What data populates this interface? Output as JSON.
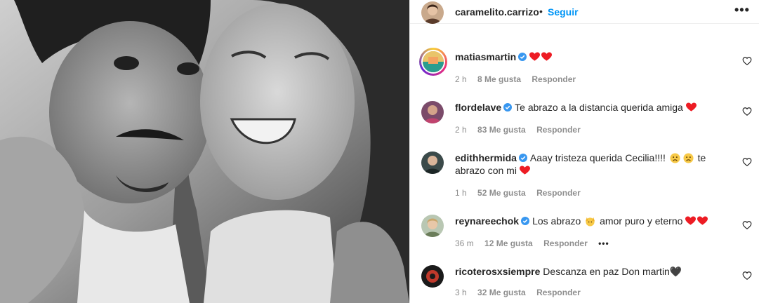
{
  "post": {
    "author": "caramelito.carrizo",
    "separator": "•",
    "follow_label": "Seguir",
    "more_icon": "more-options-icon",
    "photo_description": "black-and-white-photo"
  },
  "comments": [
    {
      "user": "matiasmartin",
      "verified": true,
      "text": "",
      "time": "2 h",
      "likes": "8 Me gusta",
      "reply_label": "Responder",
      "has_story_ring": true
    },
    {
      "user": "flordelave",
      "verified": true,
      "text": "Te abrazo a la distancia querida amiga",
      "time": "2 h",
      "likes": "83 Me gusta",
      "reply_label": "Responder"
    },
    {
      "user": "edithhermida",
      "verified": true,
      "text": "Aaay tristeza querida Cecilia!!!!",
      "text2": "te",
      "text3": "abrazo con mi",
      "time": "1 h",
      "likes": "52 Me gusta",
      "reply_label": "Responder"
    },
    {
      "user": "reynareechok",
      "verified": true,
      "text": "Los abrazo",
      "text2": "amor puro y eterno",
      "time": "36 m",
      "likes": "12 Me gusta",
      "reply_label": "Responder",
      "more_label": "•••"
    },
    {
      "user": "ricoterosxsiempre",
      "verified": false,
      "text": "Descanza en paz Don martin🖤",
      "time": "3 h",
      "likes": "32 Me gusta",
      "reply_label": "Responder"
    }
  ],
  "colors": {
    "accent": "#0095f6",
    "heart": "#ed1c24",
    "verified": "#3897f0",
    "muted": "#8e8e8e"
  }
}
